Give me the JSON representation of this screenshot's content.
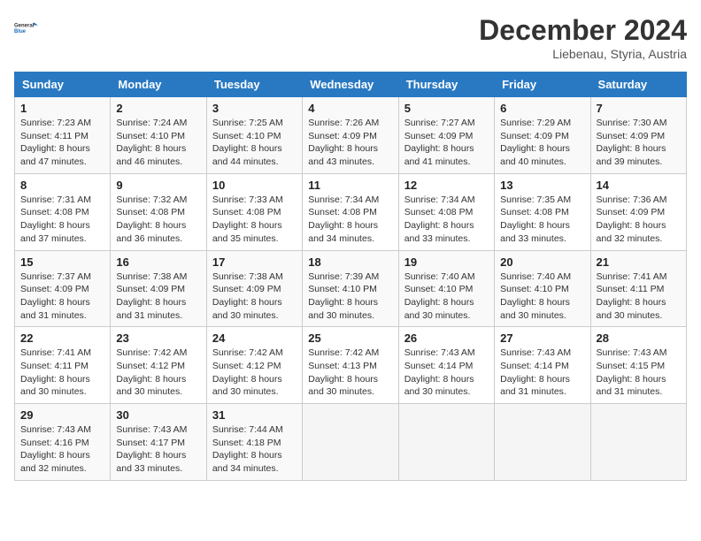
{
  "logo": {
    "line1": "General",
    "line2": "Blue"
  },
  "title": "December 2024",
  "subtitle": "Liebenau, Styria, Austria",
  "days_of_week": [
    "Sunday",
    "Monday",
    "Tuesday",
    "Wednesday",
    "Thursday",
    "Friday",
    "Saturday"
  ],
  "weeks": [
    [
      {
        "day": "1",
        "sunrise": "7:23 AM",
        "sunset": "4:11 PM",
        "daylight": "8 hours and 47 minutes."
      },
      {
        "day": "2",
        "sunrise": "7:24 AM",
        "sunset": "4:10 PM",
        "daylight": "8 hours and 46 minutes."
      },
      {
        "day": "3",
        "sunrise": "7:25 AM",
        "sunset": "4:10 PM",
        "daylight": "8 hours and 44 minutes."
      },
      {
        "day": "4",
        "sunrise": "7:26 AM",
        "sunset": "4:09 PM",
        "daylight": "8 hours and 43 minutes."
      },
      {
        "day": "5",
        "sunrise": "7:27 AM",
        "sunset": "4:09 PM",
        "daylight": "8 hours and 41 minutes."
      },
      {
        "day": "6",
        "sunrise": "7:29 AM",
        "sunset": "4:09 PM",
        "daylight": "8 hours and 40 minutes."
      },
      {
        "day": "7",
        "sunrise": "7:30 AM",
        "sunset": "4:09 PM",
        "daylight": "8 hours and 39 minutes."
      }
    ],
    [
      {
        "day": "8",
        "sunrise": "7:31 AM",
        "sunset": "4:08 PM",
        "daylight": "8 hours and 37 minutes."
      },
      {
        "day": "9",
        "sunrise": "7:32 AM",
        "sunset": "4:08 PM",
        "daylight": "8 hours and 36 minutes."
      },
      {
        "day": "10",
        "sunrise": "7:33 AM",
        "sunset": "4:08 PM",
        "daylight": "8 hours and 35 minutes."
      },
      {
        "day": "11",
        "sunrise": "7:34 AM",
        "sunset": "4:08 PM",
        "daylight": "8 hours and 34 minutes."
      },
      {
        "day": "12",
        "sunrise": "7:34 AM",
        "sunset": "4:08 PM",
        "daylight": "8 hours and 33 minutes."
      },
      {
        "day": "13",
        "sunrise": "7:35 AM",
        "sunset": "4:08 PM",
        "daylight": "8 hours and 33 minutes."
      },
      {
        "day": "14",
        "sunrise": "7:36 AM",
        "sunset": "4:09 PM",
        "daylight": "8 hours and 32 minutes."
      }
    ],
    [
      {
        "day": "15",
        "sunrise": "7:37 AM",
        "sunset": "4:09 PM",
        "daylight": "8 hours and 31 minutes."
      },
      {
        "day": "16",
        "sunrise": "7:38 AM",
        "sunset": "4:09 PM",
        "daylight": "8 hours and 31 minutes."
      },
      {
        "day": "17",
        "sunrise": "7:38 AM",
        "sunset": "4:09 PM",
        "daylight": "8 hours and 30 minutes."
      },
      {
        "day": "18",
        "sunrise": "7:39 AM",
        "sunset": "4:10 PM",
        "daylight": "8 hours and 30 minutes."
      },
      {
        "day": "19",
        "sunrise": "7:40 AM",
        "sunset": "4:10 PM",
        "daylight": "8 hours and 30 minutes."
      },
      {
        "day": "20",
        "sunrise": "7:40 AM",
        "sunset": "4:10 PM",
        "daylight": "8 hours and 30 minutes."
      },
      {
        "day": "21",
        "sunrise": "7:41 AM",
        "sunset": "4:11 PM",
        "daylight": "8 hours and 30 minutes."
      }
    ],
    [
      {
        "day": "22",
        "sunrise": "7:41 AM",
        "sunset": "4:11 PM",
        "daylight": "8 hours and 30 minutes."
      },
      {
        "day": "23",
        "sunrise": "7:42 AM",
        "sunset": "4:12 PM",
        "daylight": "8 hours and 30 minutes."
      },
      {
        "day": "24",
        "sunrise": "7:42 AM",
        "sunset": "4:12 PM",
        "daylight": "8 hours and 30 minutes."
      },
      {
        "day": "25",
        "sunrise": "7:42 AM",
        "sunset": "4:13 PM",
        "daylight": "8 hours and 30 minutes."
      },
      {
        "day": "26",
        "sunrise": "7:43 AM",
        "sunset": "4:14 PM",
        "daylight": "8 hours and 30 minutes."
      },
      {
        "day": "27",
        "sunrise": "7:43 AM",
        "sunset": "4:14 PM",
        "daylight": "8 hours and 31 minutes."
      },
      {
        "day": "28",
        "sunrise": "7:43 AM",
        "sunset": "4:15 PM",
        "daylight": "8 hours and 31 minutes."
      }
    ],
    [
      {
        "day": "29",
        "sunrise": "7:43 AM",
        "sunset": "4:16 PM",
        "daylight": "8 hours and 32 minutes."
      },
      {
        "day": "30",
        "sunrise": "7:43 AM",
        "sunset": "4:17 PM",
        "daylight": "8 hours and 33 minutes."
      },
      {
        "day": "31",
        "sunrise": "7:44 AM",
        "sunset": "4:18 PM",
        "daylight": "8 hours and 34 minutes."
      },
      null,
      null,
      null,
      null
    ]
  ],
  "labels": {
    "sunrise": "Sunrise: ",
    "sunset": "Sunset: ",
    "daylight": "Daylight: "
  }
}
